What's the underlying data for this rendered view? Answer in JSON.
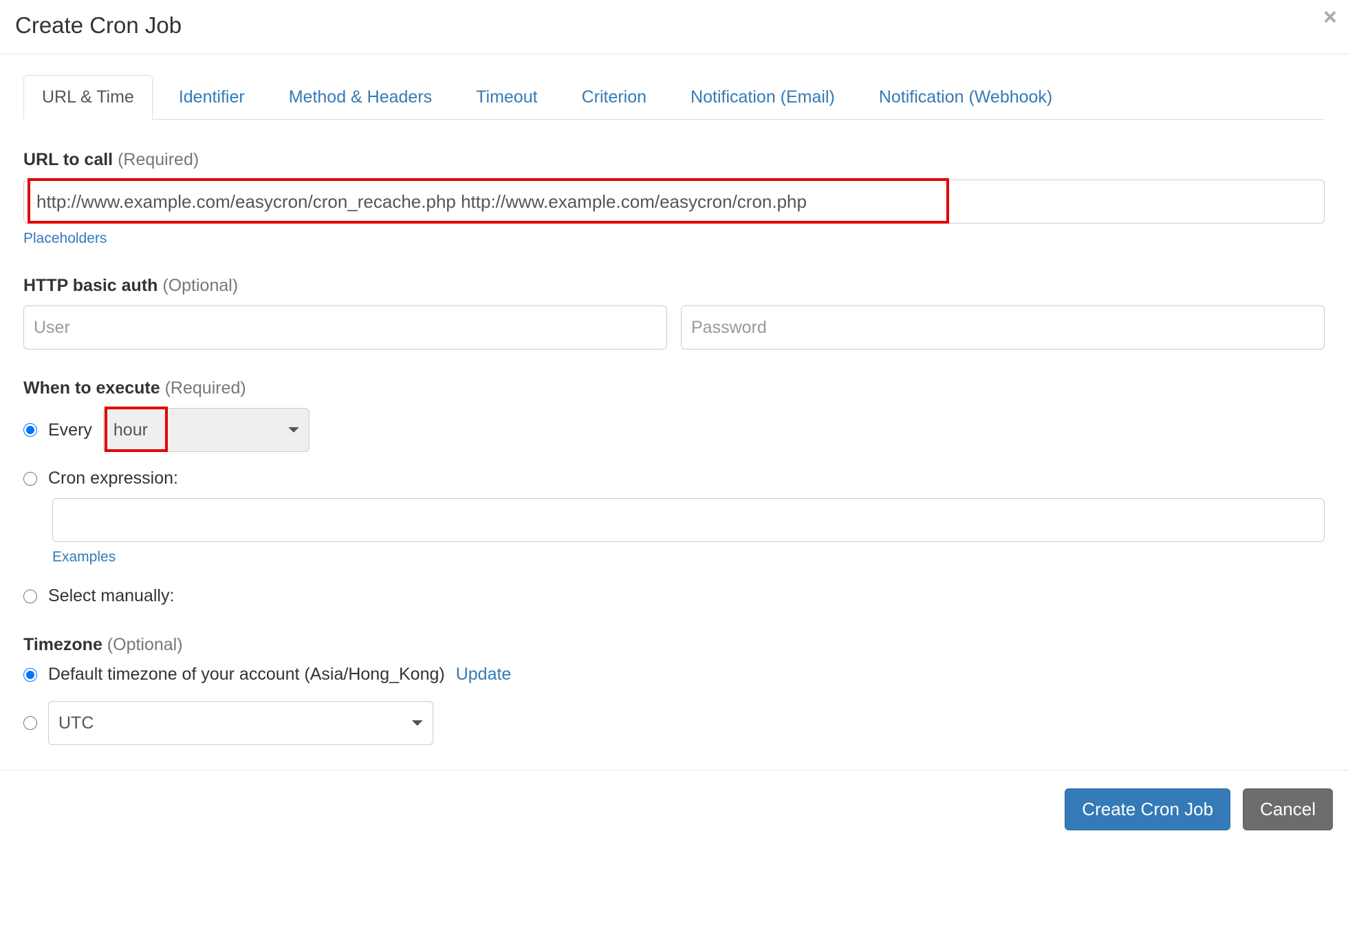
{
  "header": {
    "title": "Create Cron Job"
  },
  "tabs": [
    "URL & Time",
    "Identifier",
    "Method & Headers",
    "Timeout",
    "Criterion",
    "Notification (Email)",
    "Notification (Webhook)"
  ],
  "form": {
    "url": {
      "label": "URL to call",
      "suffix": "(Required)",
      "value": "http://www.example.com/easycron/cron_recache.php http://www.example.com/easycron/cron.php",
      "placeholders_link": "Placeholders"
    },
    "auth": {
      "label": "HTTP basic auth",
      "suffix": "(Optional)",
      "user_placeholder": "User",
      "pass_placeholder": "Password"
    },
    "when": {
      "label": "When to execute",
      "suffix": "(Required)",
      "every_label": "Every",
      "every_value": "hour",
      "cron_label": "Cron expression:",
      "examples_link": "Examples",
      "manual_label": "Select manually:"
    },
    "tz": {
      "label": "Timezone",
      "suffix": "(Optional)",
      "default_label": "Default timezone of your account (Asia/Hong_Kong)",
      "update_link": "Update",
      "utc_value": "UTC"
    }
  },
  "footer": {
    "primary": "Create Cron Job",
    "cancel": "Cancel"
  }
}
